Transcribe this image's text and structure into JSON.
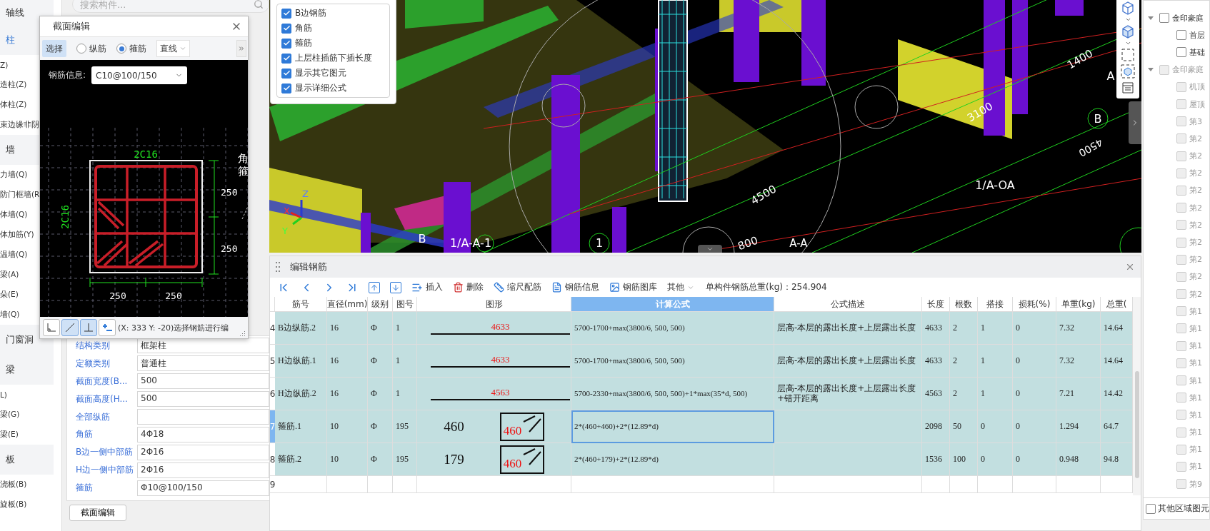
{
  "sidebar": {
    "items": [
      {
        "label": "轴线",
        "kind": "header",
        "selected": false
      },
      {
        "label": "柱",
        "kind": "header",
        "selected": true
      },
      {
        "label": "Z)",
        "kind": "item",
        "selected": false
      },
      {
        "label": "造柱(Z)",
        "kind": "item",
        "selected": false
      },
      {
        "label": "体柱(Z)",
        "kind": "item",
        "selected": false
      },
      {
        "label": "束边缘非阴",
        "kind": "item",
        "selected": false
      },
      {
        "label": "墙",
        "kind": "header",
        "selected": false
      },
      {
        "label": "力墙(Q)",
        "kind": "item",
        "selected": false
      },
      {
        "label": "防门框墙(R",
        "kind": "item",
        "selected": false
      },
      {
        "label": "体墙(Q)",
        "kind": "item",
        "selected": false
      },
      {
        "label": "体加筋(Y)",
        "kind": "item",
        "selected": false
      },
      {
        "label": "温墙(Q)",
        "kind": "item",
        "selected": false
      },
      {
        "label": "梁(A)",
        "kind": "item",
        "selected": false
      },
      {
        "label": "朵(E)",
        "kind": "item",
        "selected": false
      },
      {
        "label": "墙(Q)",
        "kind": "item",
        "selected": false
      },
      {
        "label": "门窗洞",
        "kind": "header",
        "selected": false
      },
      {
        "label": "梁",
        "kind": "header",
        "selected": false
      },
      {
        "label": "L)",
        "kind": "item",
        "selected": false
      },
      {
        "label": "梁(G)",
        "kind": "item",
        "selected": false
      },
      {
        "label": "梁(E)",
        "kind": "item",
        "selected": false
      },
      {
        "label": "板",
        "kind": "header",
        "selected": false
      },
      {
        "label": "浇板(B)",
        "kind": "item",
        "selected": false
      },
      {
        "label": "旋板(B)",
        "kind": "item",
        "selected": false
      }
    ]
  },
  "search": {
    "placeholder": "搜索构件..."
  },
  "properties": {
    "rows": [
      {
        "label": "结构类别",
        "value": "框架柱"
      },
      {
        "label": "定额类别",
        "value": "普通柱"
      },
      {
        "label": "截面宽度(B...",
        "value": "500"
      },
      {
        "label": "截面高度(H...",
        "value": "500"
      },
      {
        "label": "全部纵筋"
      },
      {
        "label": "角筋",
        "value": "4Φ18"
      },
      {
        "label": "B边一侧中部筋",
        "value": "2Φ16"
      },
      {
        "label": "H边一侧中部筋",
        "value": "2Φ16"
      },
      {
        "label": "箍筋",
        "value": "Φ10@100/150"
      }
    ],
    "button": "截面编辑"
  },
  "dialog": {
    "title": "截面编辑",
    "select_button": {
      "label": "选择",
      "selected": true
    },
    "radios": [
      {
        "label": "纵筋",
        "selected": false
      },
      {
        "label": "箍筋",
        "selected": true
      }
    ],
    "line_dropdown": "直线",
    "rebar_info_label": "钢筋信息:",
    "rebar_info_value": "C10@100/150",
    "section": {
      "top_label": "2C16",
      "left_label": "2C16",
      "right_dims": [
        "250",
        "250"
      ],
      "bottom_dims": [
        "250",
        "250"
      ],
      "callouts": [
        "角",
        "箍"
      ]
    },
    "tools": [
      {
        "kind": "corner",
        "selected": false
      },
      {
        "kind": "diagonal",
        "selected": true
      },
      {
        "kind": "perpendicular",
        "selected": true
      },
      {
        "kind": "add",
        "selected": false
      }
    ],
    "status": "(X: 333 Y: -20)选择钢筋进行编"
  },
  "view": {
    "options": [
      {
        "label": "B边钢筋",
        "checked": true
      },
      {
        "label": "角筋",
        "checked": true
      },
      {
        "label": "箍筋",
        "checked": true
      },
      {
        "label": "上层柱插筋下插长度",
        "checked": true
      },
      {
        "label": "显示其它图元",
        "checked": true
      },
      {
        "label": "显示详细公式",
        "checked": true
      }
    ],
    "grid_labels": [
      "1400",
      "3100",
      "4500",
      "1/A-OA",
      "B",
      "A",
      "4500",
      "B",
      "1/A-A-1",
      "1",
      "800",
      "A-A"
    ],
    "axis": [
      "X",
      "Y",
      "Z"
    ]
  },
  "rebar_panel": {
    "title": "编辑钢筋",
    "actions": [
      {
        "kind": "insert",
        "label": "插入"
      },
      {
        "kind": "delete",
        "label": "删除"
      },
      {
        "kind": "scale",
        "label": "缩尺配筋"
      },
      {
        "kind": "info",
        "label": "钢筋信息"
      },
      {
        "kind": "library",
        "label": "钢筋图库"
      }
    ],
    "more": "其他",
    "total": "单构件钢筋总重(kg)：254.904",
    "columns": [
      {
        "label": "筋号",
        "selected": false
      },
      {
        "label": "直径(mm)",
        "selected": false
      },
      {
        "label": "级别",
        "selected": false
      },
      {
        "label": "图号",
        "selected": false
      },
      {
        "label": "图形",
        "selected": false
      },
      {
        "label": "计算公式",
        "selected": true
      },
      {
        "label": "公式描述",
        "selected": false
      },
      {
        "label": "长度",
        "selected": false
      },
      {
        "label": "根数",
        "selected": false
      },
      {
        "label": "搭接",
        "selected": false
      },
      {
        "label": "损耗(%)",
        "selected": false
      },
      {
        "label": "单重(kg)",
        "selected": false
      },
      {
        "label": "总重(",
        "selected": false
      }
    ],
    "rows": [
      {
        "number": "4",
        "selected": false,
        "name": "B边纵筋.2",
        "diameter": "16",
        "grade": "Φ",
        "shape_no": "1",
        "shape": {
          "kind": "straight",
          "length": "4633"
        },
        "formula": "5700-1700+max(3800/6, 500, 500)",
        "description": "层高-本层的露出长度+上层露出长度",
        "length": "4633",
        "count": "2",
        "lap": "1",
        "loss": "0",
        "unit_weight": "7.32",
        "total_weight": "14.64"
      },
      {
        "number": "5",
        "selected": false,
        "name": "H边纵筋.1",
        "diameter": "16",
        "grade": "Φ",
        "shape_no": "1",
        "shape": {
          "kind": "straight",
          "length": "4633"
        },
        "formula": "5700-1700+max(3800/6, 500, 500)",
        "description": "层高-本层的露出长度+上层露出长度",
        "length": "4633",
        "count": "2",
        "lap": "1",
        "loss": "0",
        "unit_weight": "7.32",
        "total_weight": "14.64"
      },
      {
        "number": "6",
        "selected": false,
        "name": "H边纵筋.2",
        "diameter": "16",
        "grade": "Φ",
        "shape_no": "1",
        "shape": {
          "kind": "straight",
          "length": "4563"
        },
        "formula": "5700-2330+max(3800/6, 500, 500)+1*max(35*d, 500)",
        "description": "层高-本层的露出长度+上层露出长度+错开距离",
        "length": "4563",
        "count": "2",
        "lap": "1",
        "loss": "0",
        "unit_weight": "7.21",
        "total_weight": "14.42"
      },
      {
        "number": "7",
        "selected": true,
        "name": "箍筋.1",
        "diameter": "10",
        "grade": "Φ",
        "shape_no": "195",
        "shape": {
          "kind": "stirrup",
          "side": "460",
          "inner": "460"
        },
        "formula": "2*(460+460)+2*(12.89*d)",
        "length": "2098",
        "count": "50",
        "lap": "0",
        "loss": "0",
        "unit_weight": "1.294",
        "total_weight": "64.7"
      },
      {
        "number": "8",
        "selected": false,
        "name": "箍筋.2",
        "diameter": "10",
        "grade": "Φ",
        "shape_no": "195",
        "shape": {
          "kind": "stirrup",
          "side": "179",
          "inner": "460"
        },
        "formula": "2*(460+179)+2*(12.89*d)",
        "length": "1536",
        "count": "100",
        "lap": "0",
        "loss": "0",
        "unit_weight": "0.948",
        "total_weight": "94.8"
      },
      {
        "number": "9",
        "selected": false
      }
    ]
  },
  "floors": {
    "groups": [
      {
        "label": "金印豪庭",
        "expanded": true,
        "checked": false,
        "disabled": false,
        "children": [
          {
            "label": "首层",
            "checked": false,
            "disabled": false
          },
          {
            "label": "基础",
            "checked": false,
            "disabled": false
          }
        ]
      },
      {
        "label": "金印豪庭",
        "expanded": true,
        "checked": false,
        "disabled": true,
        "children": [
          {
            "label": "机顶",
            "checked": false,
            "disabled": true
          },
          {
            "label": "屋顶",
            "checked": false,
            "disabled": true
          },
          {
            "label": "第3",
            "checked": false,
            "disabled": true
          },
          {
            "label": "第2",
            "checked": false,
            "disabled": true
          },
          {
            "label": "第2",
            "checked": false,
            "disabled": true
          },
          {
            "label": "第2",
            "checked": false,
            "disabled": true
          },
          {
            "label": "第2",
            "checked": false,
            "disabled": true
          },
          {
            "label": "第2",
            "checked": false,
            "disabled": true
          },
          {
            "label": "第2",
            "checked": false,
            "disabled": true
          },
          {
            "label": "第2",
            "checked": false,
            "disabled": true
          },
          {
            "label": "第2",
            "checked": false,
            "disabled": true
          },
          {
            "label": "第2",
            "checked": false,
            "disabled": true
          },
          {
            "label": "第2",
            "checked": false,
            "disabled": true
          },
          {
            "label": "第1",
            "checked": false,
            "disabled": true
          },
          {
            "label": "第1",
            "checked": false,
            "disabled": true
          },
          {
            "label": "第1",
            "checked": false,
            "disabled": true
          },
          {
            "label": "第1",
            "checked": false,
            "disabled": true
          },
          {
            "label": "第1",
            "checked": false,
            "disabled": true
          },
          {
            "label": "第1",
            "checked": false,
            "disabled": true
          },
          {
            "label": "第1",
            "checked": false,
            "disabled": true
          },
          {
            "label": "第1",
            "checked": false,
            "disabled": true
          },
          {
            "label": "第1",
            "checked": false,
            "disabled": true
          },
          {
            "label": "第1",
            "checked": false,
            "disabled": true
          },
          {
            "label": "第9",
            "checked": false,
            "disabled": true
          }
        ]
      }
    ],
    "other_option": {
      "label": "其他区域图元",
      "checked": false
    }
  }
}
